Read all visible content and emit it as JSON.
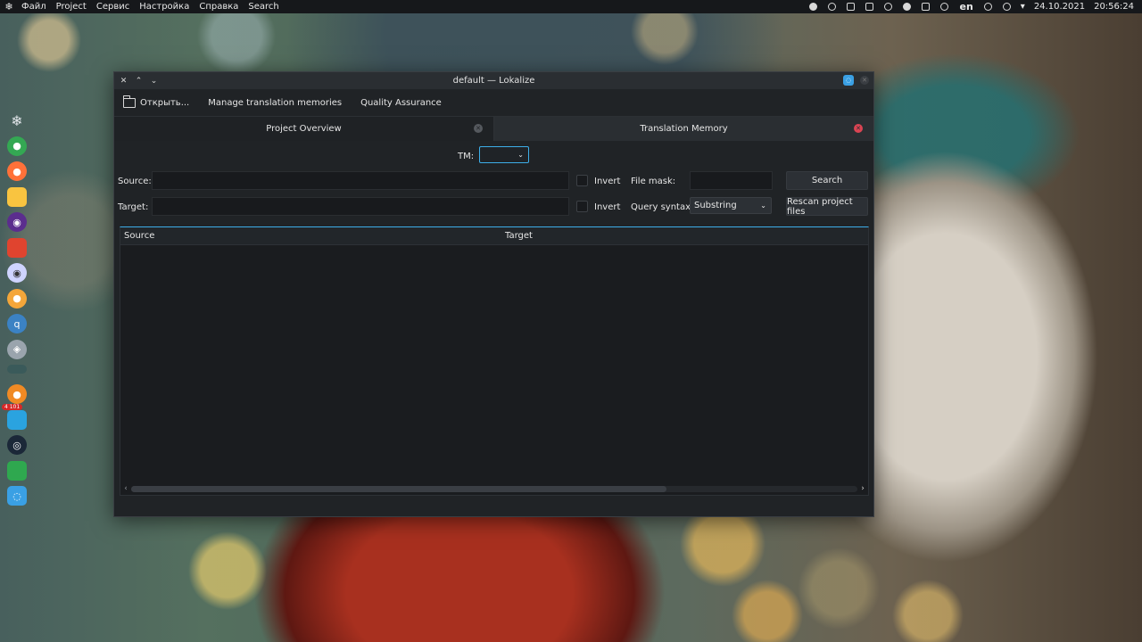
{
  "top_panel": {
    "logo_icon": "snowflake-icon",
    "menu": [
      "Файл",
      "Project",
      "Сервис",
      "Настройка",
      "Справка",
      "Search"
    ],
    "tray": {
      "language": "en",
      "date": "24.10.2021",
      "time": "20:56:24"
    }
  },
  "dock": {
    "apps": [
      {
        "name": "snowflake",
        "icon": "snowflake-icon",
        "color": "#e0e4e8"
      },
      {
        "name": "chrome",
        "icon": "chrome-icon",
        "color": "#34a853"
      },
      {
        "name": "firefox",
        "icon": "firefox-icon",
        "color": "#ff7139"
      },
      {
        "name": "notes",
        "icon": "notes-icon",
        "color": "#f9c440"
      },
      {
        "name": "app-purple",
        "icon": "purple-app-icon",
        "color": "#5b2d8e"
      },
      {
        "name": "app-red",
        "icon": "red-app-icon",
        "color": "#e0442f"
      },
      {
        "name": "camera",
        "icon": "camera-icon",
        "color": "#cfd4ff"
      },
      {
        "name": "app-orange-circle",
        "icon": "orange-circle-icon",
        "color": "#f4a63a"
      },
      {
        "name": "qbittorrent",
        "icon": "qbittorrent-icon",
        "color": "#3b82c4"
      },
      {
        "name": "app-grey",
        "icon": "grey-app-icon",
        "color": "#9aa4ad"
      },
      {
        "name": "terminal",
        "icon": "terminal-icon",
        "color": "#3a5a5a"
      },
      {
        "name": "app-orange",
        "icon": "orange-app-icon",
        "color": "#f08a24"
      },
      {
        "name": "telegram",
        "icon": "telegram-icon",
        "color": "#2aa3e0",
        "badge": "4 101"
      },
      {
        "name": "steam",
        "icon": "steam-icon",
        "color": "#1b2838"
      },
      {
        "name": "app-green",
        "icon": "green-app-icon",
        "color": "#2fa84f"
      },
      {
        "name": "lokalize",
        "icon": "lokalize-icon",
        "color": "#3aa0e4"
      }
    ]
  },
  "window": {
    "title": "default — Lokalize",
    "toolbar": {
      "open_label": "Открыть...",
      "manage_tm_label": "Manage translation memories",
      "qa_label": "Quality Assurance"
    },
    "tabs": [
      {
        "label": "Project Overview",
        "active": false
      },
      {
        "label": "Translation Memory",
        "active": true
      }
    ],
    "tm": {
      "tm_label": "TM:",
      "tm_value": "",
      "source_label": "Source:",
      "target_label": "Target:",
      "invert_label": "Invert",
      "file_mask_label": "File mask:",
      "file_mask_value": "",
      "query_syntax_label": "Query syntax:",
      "query_syntax_value": "Substring",
      "search_button": "Search",
      "rescan_button": "Rescan project files",
      "columns": [
        "Source",
        "Target"
      ],
      "rows": []
    }
  }
}
